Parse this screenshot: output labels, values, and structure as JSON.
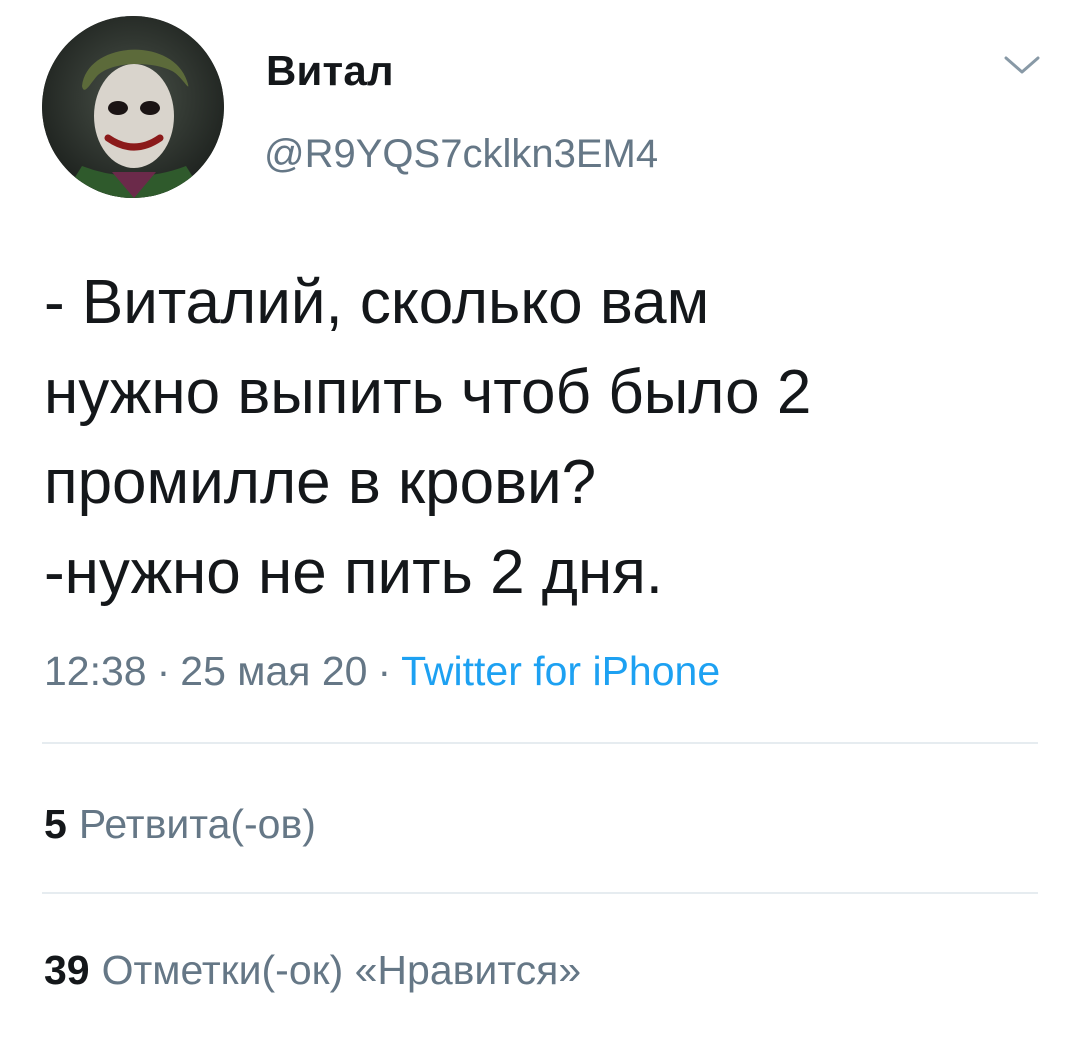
{
  "author": {
    "display_name": "Витал",
    "handle": "@R9YQS7cklkn3EM4"
  },
  "tweet": {
    "lines": [
      "- Виталий, сколько вам",
      "нужно выпить чтоб было 2",
      "промилле в крови?",
      "-нужно не пить 2 дня."
    ],
    "time": "12:38",
    "date": "25 мая 20",
    "separator": "·",
    "source": "Twitter for iPhone"
  },
  "stats": {
    "retweets_count": "5",
    "retweets_label": "Ретвита(-ов)",
    "likes_count": "39",
    "likes_label": "Отметки(-ок) «Нравится»"
  },
  "icons": {
    "menu": "chevron-down-icon"
  },
  "colors": {
    "text": "#14171a",
    "secondary": "#657786",
    "link": "#1da1f2",
    "divider": "#e6ecf0"
  }
}
